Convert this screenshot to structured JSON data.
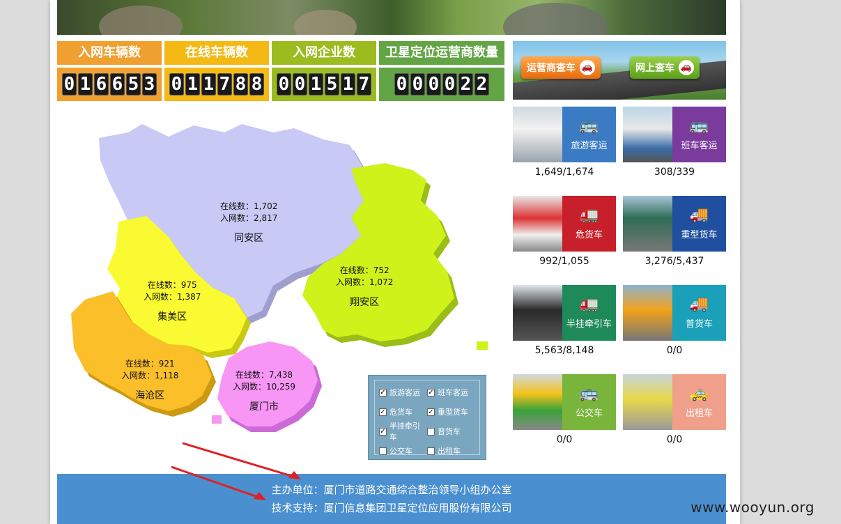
{
  "stats": [
    {
      "label": "入网车辆数",
      "digits": [
        "0",
        "1",
        "6",
        "6",
        "5",
        "3"
      ],
      "color": "#f0a030"
    },
    {
      "label": "在线车辆数",
      "digits": [
        "0",
        "1",
        "1",
        "7",
        "8",
        "8"
      ],
      "color": "#f4b915"
    },
    {
      "label": "入网企业数",
      "digits": [
        "0",
        "0",
        "1",
        "5",
        "1",
        "7"
      ],
      "color": "#9bbb1e"
    },
    {
      "label": "卫星定位运营商数量",
      "digits": [
        "0",
        "0",
        "0",
        "0",
        "2",
        "2"
      ],
      "color": "#63a545"
    }
  ],
  "regions": [
    {
      "name": "同安区",
      "online": "在线数：1,702",
      "registered": "入网数：2,817"
    },
    {
      "name": "翔安区",
      "online": "在线数：752",
      "registered": "入网数：1,072"
    },
    {
      "name": "集美区",
      "online": "在线数：975",
      "registered": "入网数：1,387"
    },
    {
      "name": "海沧区",
      "online": "在线数：921",
      "registered": "入网数：1,118"
    },
    {
      "name": "厦门市",
      "online": "在线数：7,438",
      "registered": "入网数：10,259"
    }
  ],
  "legend": [
    {
      "label": "旅游客运",
      "checked": true
    },
    {
      "label": "班车客运",
      "checked": true
    },
    {
      "label": "危货车",
      "checked": true
    },
    {
      "label": "重型货车",
      "checked": true
    },
    {
      "label": "半挂牵引车",
      "checked": true
    },
    {
      "label": "普货车",
      "checked": false
    },
    {
      "label": "公交车",
      "checked": false
    },
    {
      "label": "出租车",
      "checked": false
    }
  ],
  "search": {
    "operator_label": "运营商查车",
    "online_label": "网上查车"
  },
  "vehicles": [
    {
      "label": "旅游客运",
      "count": "1,649/1,674",
      "color": "#3b7bc4",
      "icon": "bus-icon"
    },
    {
      "label": "班车客运",
      "count": "308/339",
      "color": "#7b3b9c",
      "icon": "bus-icon"
    },
    {
      "label": "危货车",
      "count": "992/1,055",
      "color": "#c8202a",
      "icon": "tanker-icon"
    },
    {
      "label": "重型货车",
      "count": "3,276/5,437",
      "color": "#1f4f9e",
      "icon": "truck-icon"
    },
    {
      "label": "半挂牵引车",
      "count": "5,563/8,148",
      "color": "#1e8a5a",
      "icon": "tractor-icon"
    },
    {
      "label": "普货车",
      "count": "0/0",
      "color": "#1aa0b8",
      "icon": "truck-icon"
    },
    {
      "label": "公交车",
      "count": "0/0",
      "color": "#79b53a",
      "icon": "bus-icon"
    },
    {
      "label": "出租车",
      "count": "0/0",
      "color": "#f0a08a",
      "icon": "taxi-icon"
    }
  ],
  "footer": {
    "host": "主办单位：厦门市道路交通综合整治领导小组办公室",
    "support": "技术支持：厦门信息集团卫星定位应用股份有限公司"
  },
  "watermark": "www.wooyun.org"
}
